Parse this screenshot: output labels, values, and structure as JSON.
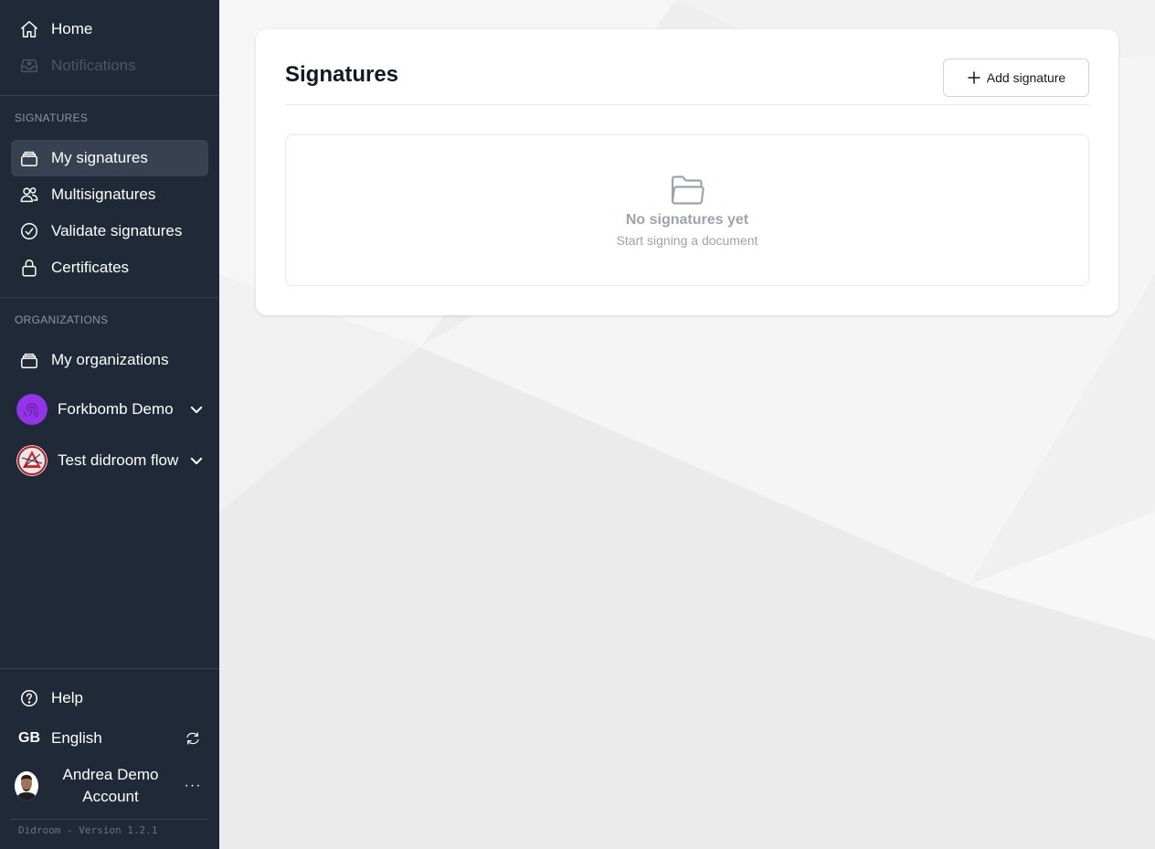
{
  "sidebar": {
    "top_items": [
      {
        "label": "Home",
        "icon": "home-icon"
      },
      {
        "label": "Notifications",
        "icon": "inbox-icon",
        "disabled": true
      }
    ],
    "signatures_section": {
      "label": "SIGNATURES",
      "items": [
        {
          "label": "My signatures",
          "icon": "stack-icon",
          "active": true
        },
        {
          "label": "Multisignatures",
          "icon": "users-icon"
        },
        {
          "label": "Validate signatures",
          "icon": "check-circle-icon"
        },
        {
          "label": "Certificates",
          "icon": "lock-icon"
        }
      ]
    },
    "organizations_section": {
      "label": "ORGANIZATIONS",
      "items": [
        {
          "label": "My organizations",
          "icon": "stack-icon"
        }
      ],
      "orgs": [
        {
          "name": "Forkbomb Demo"
        },
        {
          "name": "Test didroom flow"
        }
      ]
    },
    "bottom": {
      "help": "Help",
      "language_code": "GB",
      "language": "English",
      "user_name": "Andrea Demo Account",
      "more": "···",
      "version": "Didroom - Version 1.2.1"
    }
  },
  "main": {
    "title": "Signatures",
    "add_button": "Add signature",
    "empty": {
      "title": "No signatures yet",
      "subtitle": "Start signing a document"
    }
  },
  "colors": {
    "sidebar_bg": "#1f2937",
    "active_item_bg": "#374151",
    "muted_text": "#9ca3af"
  }
}
